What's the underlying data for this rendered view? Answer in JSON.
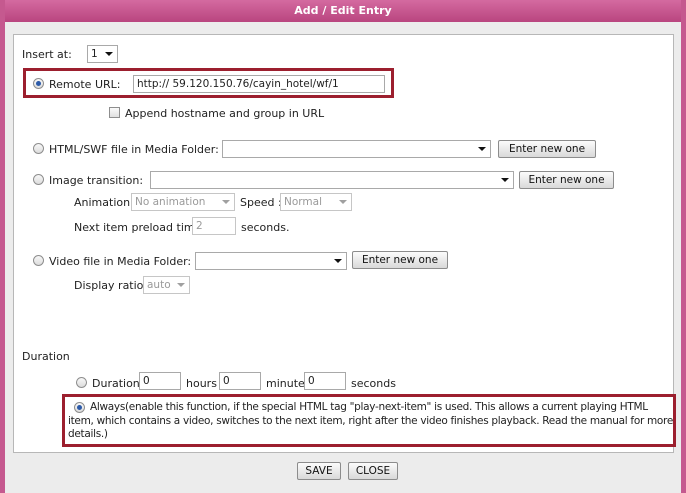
{
  "title": "Add / Edit Entry",
  "insert": {
    "label": "Insert at:",
    "value": "1"
  },
  "remote": {
    "label": "Remote URL:",
    "url": "http:// 59.120.150.76/cayin_hotel/wf/1",
    "append_label": "Append hostname and group in URL"
  },
  "html_swf": {
    "label": "HTML/SWF file in Media Folder:",
    "value": "",
    "button": "Enter new one"
  },
  "image": {
    "label": "Image transition:",
    "value": "",
    "button": "Enter new one",
    "animation_label": "Animation:",
    "animation_value": "No animation",
    "speed_label": "Speed :",
    "speed_value": "Normal",
    "preload_label": "Next item preload time:",
    "preload_value": "2",
    "preload_unit": "seconds."
  },
  "video": {
    "label": "Video file in Media Folder:",
    "value": "",
    "button": "Enter new one",
    "ratio_label": "Display ratio:",
    "ratio_value": "auto"
  },
  "duration": {
    "heading": "Duration",
    "option_label": "Duration",
    "hours_value": "0",
    "hours_label": "hours",
    "minutes_value": "0",
    "minutes_label": "minutes",
    "seconds_value": "0",
    "seconds_label": "seconds",
    "always_line1": "Always(enable this function, if the special HTML tag \"play-next-item\" is used. This allows a current playing HTML",
    "always_line2": "item, which contains a video, switches to the next item, right after the video finishes playback. Read the manual for more",
    "always_line3": "details.)"
  },
  "actions": {
    "save": "SAVE",
    "close": "CLOSE"
  },
  "colors": {
    "title_bar": "#c5598f",
    "highlight_border": "#9c1f2e",
    "background": "#ececec"
  }
}
